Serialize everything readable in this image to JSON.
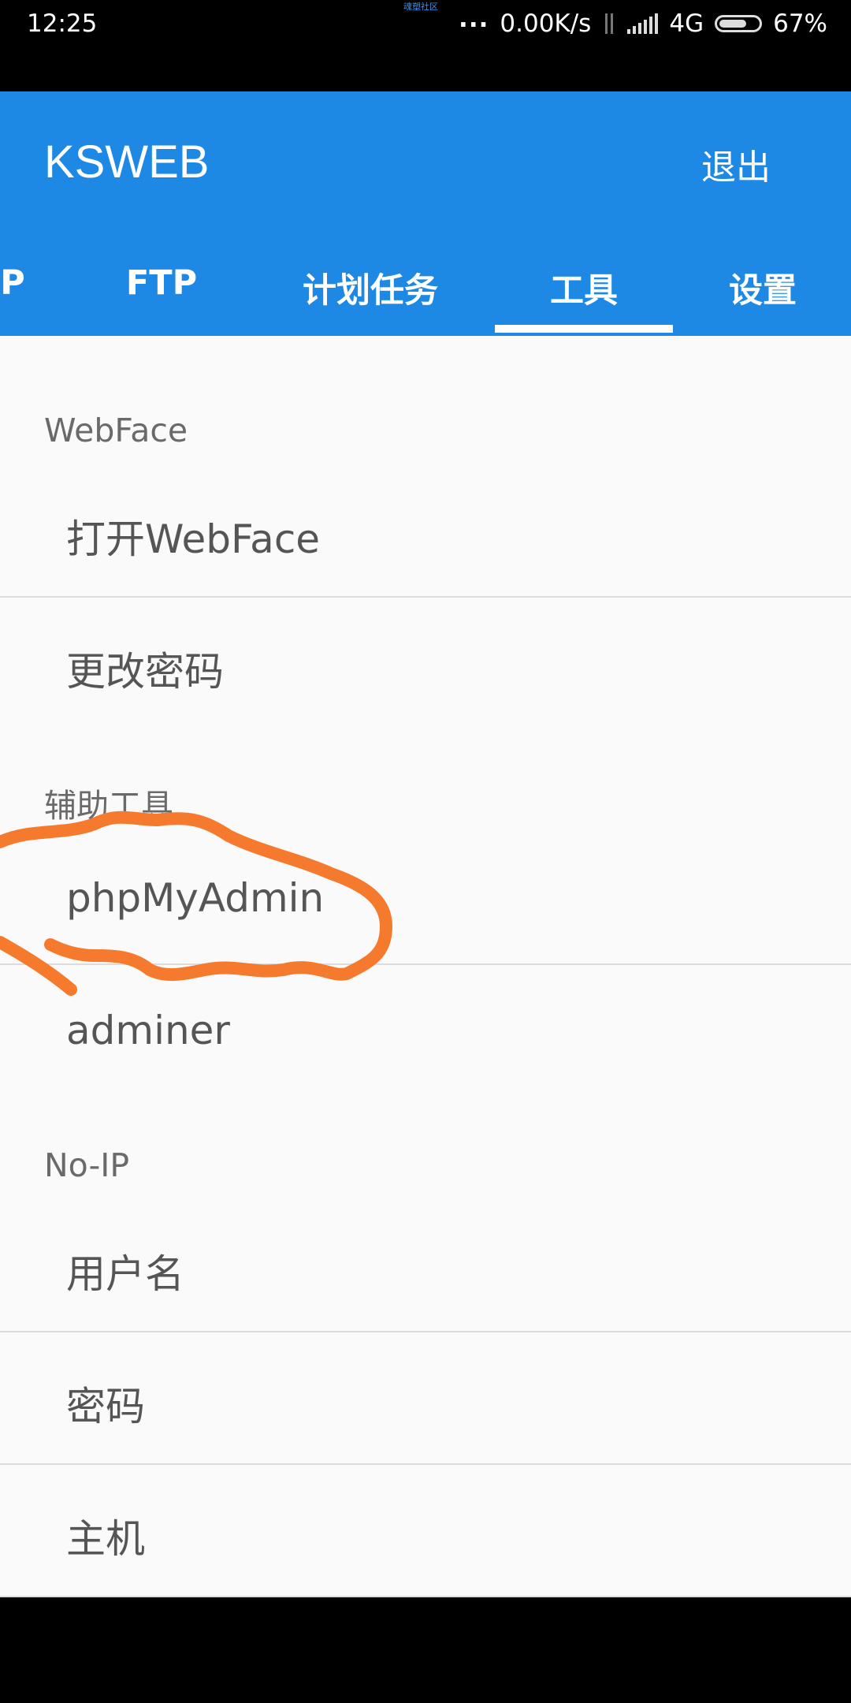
{
  "status_bar": {
    "time": "12:25",
    "watermark": "魂塑社区",
    "dots": "...",
    "network_speed": "0.00K/s",
    "network_type": "4G",
    "battery": "67%",
    "battery_level": 0.67
  },
  "app_bar": {
    "title": "KSWEB",
    "logout_label": "退出",
    "background_color": "#1e88e5"
  },
  "tabs": [
    {
      "label": "P",
      "active": false
    },
    {
      "label": "FTP",
      "active": false
    },
    {
      "label": "计划任务",
      "active": false
    },
    {
      "label": "工具",
      "active": true
    },
    {
      "label": "设置",
      "active": false
    }
  ],
  "sections": [
    {
      "header": "WebFace",
      "items": [
        "打开WebFace",
        "更改密码"
      ]
    },
    {
      "header": "辅助工具",
      "items": [
        "phpMyAdmin",
        "adminer"
      ]
    },
    {
      "header": "No-IP",
      "items": [
        "用户名",
        "密码",
        "主机"
      ]
    }
  ],
  "annotation": {
    "color": "#f57a2e",
    "target": "phpMyAdmin"
  }
}
